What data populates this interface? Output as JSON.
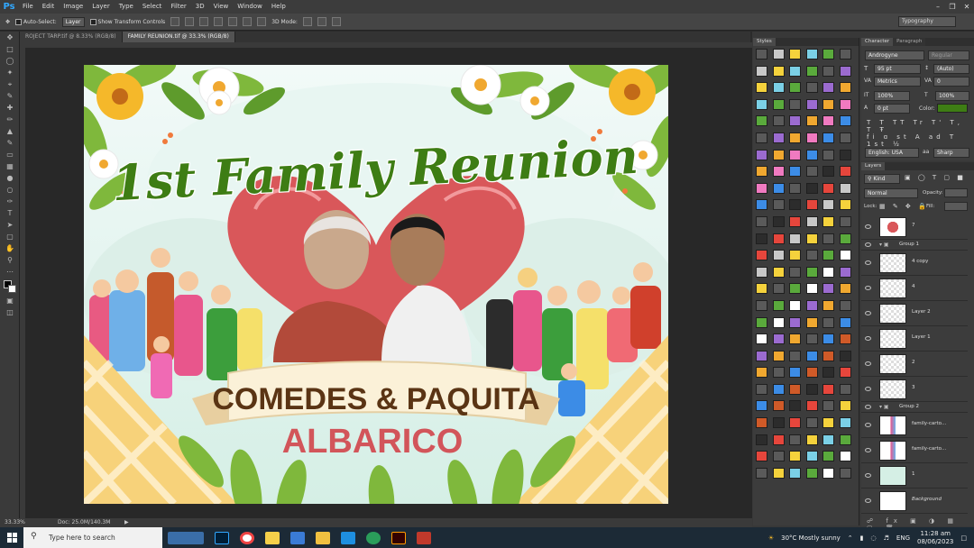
{
  "app": {
    "logo": "Ps"
  },
  "menu": [
    "File",
    "Edit",
    "Image",
    "Layer",
    "Type",
    "Select",
    "Filter",
    "3D",
    "View",
    "Window",
    "Help"
  ],
  "options": {
    "auto_select": "Auto-Select:",
    "auto_select_value": "Layer",
    "transform": "Show Transform Controls",
    "mode3d": "3D Mode:",
    "workspace": "Typography"
  },
  "tabs": [
    {
      "label": "ROJECT TARP.tif @ 8.33% (RGB/8)"
    },
    {
      "label": "FAMILY REUNION.tif @ 33.3% (RGB/8)"
    }
  ],
  "status": {
    "zoom": "33.33%",
    "doc": "Doc: 25.0M/140.3M"
  },
  "poster": {
    "title": "1st Family Reunion",
    "banner_name": "COMEDES & PAQUITA",
    "surname": "ALBARICO"
  },
  "panels": {
    "styles_tab": "Styles",
    "character_tab": "Character",
    "paragraph_tab": "Paragraph",
    "layers_tab": "Layers"
  },
  "character": {
    "font": "Androgyne",
    "style": "Regular",
    "size": "95 pt",
    "leading": "(Auto)",
    "kerning": "Metrics",
    "tracking": "0",
    "vscale": "100%",
    "hscale": "100%",
    "baseline": "0 pt",
    "color_label": "Color:",
    "color": "#3e7d14",
    "language": "English: USA",
    "antialias": "Sharp"
  },
  "layers_panel": {
    "kind": "Kind",
    "blend": "Normal",
    "opacity_label": "Opacity:",
    "lock_label": "Lock:",
    "fill_label": "Fill:"
  },
  "layers": [
    {
      "name": "7",
      "thumb": "heart"
    },
    {
      "name": "Group 1",
      "group": true
    },
    {
      "name": "4 copy",
      "thumb": "blank"
    },
    {
      "name": "4",
      "thumb": "blank"
    },
    {
      "name": "Layer 2",
      "thumb": "blank"
    },
    {
      "name": "Layer 1",
      "thumb": "blank"
    },
    {
      "name": "2",
      "thumb": "blank"
    },
    {
      "name": "3",
      "thumb": "blank"
    },
    {
      "name": "Group 2",
      "group": true
    },
    {
      "name": "family-carto...",
      "thumb": "people"
    },
    {
      "name": "family-carto...",
      "thumb": "people"
    },
    {
      "name": "1",
      "thumb": "mint"
    },
    {
      "name": "Background",
      "thumb": "white"
    }
  ],
  "taskbar": {
    "search_placeholder": "Type here to search",
    "weather": "30°C  Mostly sunny",
    "lang": "ENG",
    "time": "11:28 am",
    "date": "08/06/2023"
  },
  "swatch_colors": [
    "#e6463c",
    "#f0a830",
    "#f5d23c",
    "#3c8ce6",
    "#5aaa3c",
    "#2c2c2c",
    "#9b6bd0",
    "#c8c8c8",
    "#f07ac0",
    "#7bd0e6",
    "#d05a28",
    "#ffffff"
  ]
}
